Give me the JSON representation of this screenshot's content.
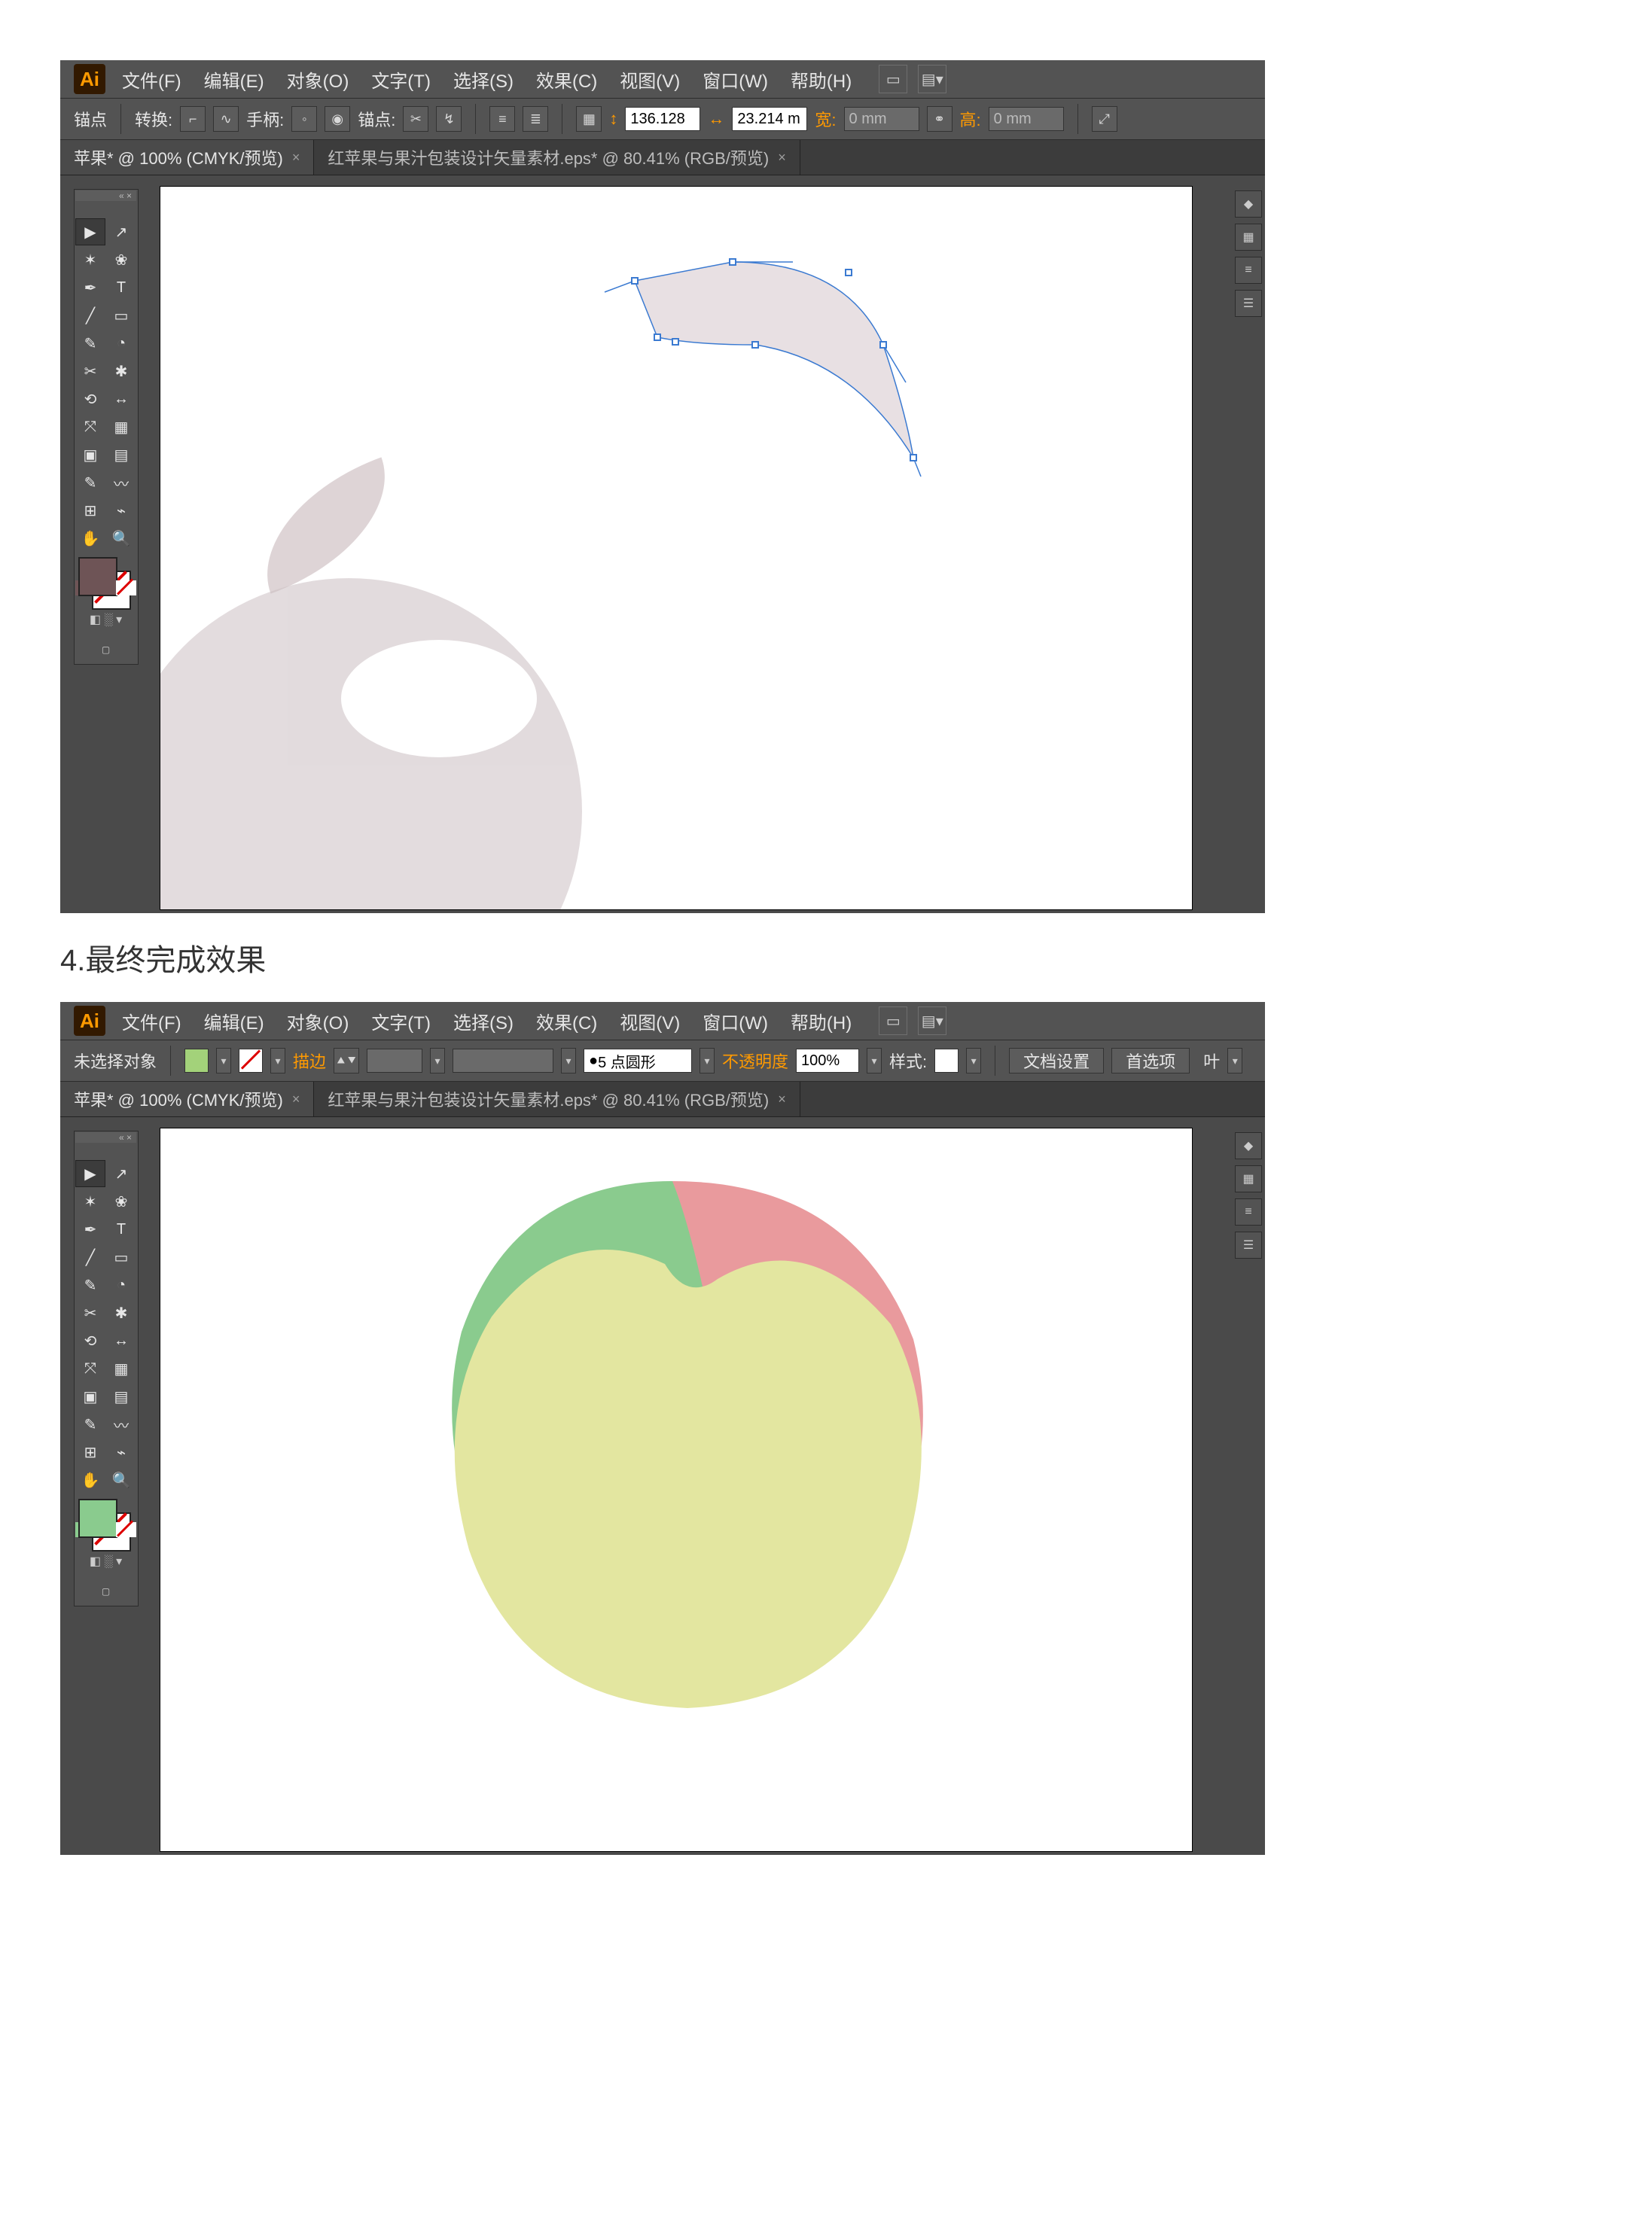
{
  "caption_final": "4.最终完成效果",
  "ai_logo": "Ai",
  "menus": [
    "文件(F)",
    "编辑(E)",
    "对象(O)",
    "文字(T)",
    "选择(S)",
    "效果(C)",
    "视图(V)",
    "窗口(W)",
    "帮助(H)"
  ],
  "win1": {
    "control": {
      "anchor_label": "锚点",
      "convert_label": "转换:",
      "handles_label": "手柄:",
      "anchors_label": "锚点:",
      "w_label": "宽:",
      "h_label": "高:",
      "w_value": "136.128",
      "h_value": "23.214 m",
      "x_value": "0 mm",
      "y_value": "0 mm"
    },
    "tabs": [
      {
        "label": "苹果* @ 100% (CMYK/预览)",
        "active": true
      },
      {
        "label": "红苹果与果汁包装设计矢量素材.eps* @ 80.41% (RGB/预览)",
        "active": false
      }
    ]
  },
  "win2": {
    "control": {
      "noselection": "未选择对象",
      "stroke_label": "描边",
      "brushprofile": "5 点圆形",
      "opacity_label": "不透明度",
      "opacity_value": "100%",
      "style_label": "样式:",
      "docsetup": "文档设置",
      "prefs": "首选项",
      "more": "叶"
    },
    "tabs": [
      {
        "label": "苹果* @ 100% (CMYK/预览)",
        "active": true
      },
      {
        "label": "红苹果与果汁包装设计矢量素材.eps* @ 80.41% (RGB/预览)",
        "active": false
      }
    ]
  },
  "tool_icons": [
    "▶",
    "↗",
    "✶",
    "❀",
    "✒",
    "T",
    "╱",
    "▭",
    "✎",
    "◔",
    "✂",
    "✱",
    "⟲",
    "↔",
    "⤧",
    "▦",
    "▣",
    "▤",
    "✎",
    "〰",
    "⊞",
    "⌁",
    "✋",
    "🔍"
  ]
}
